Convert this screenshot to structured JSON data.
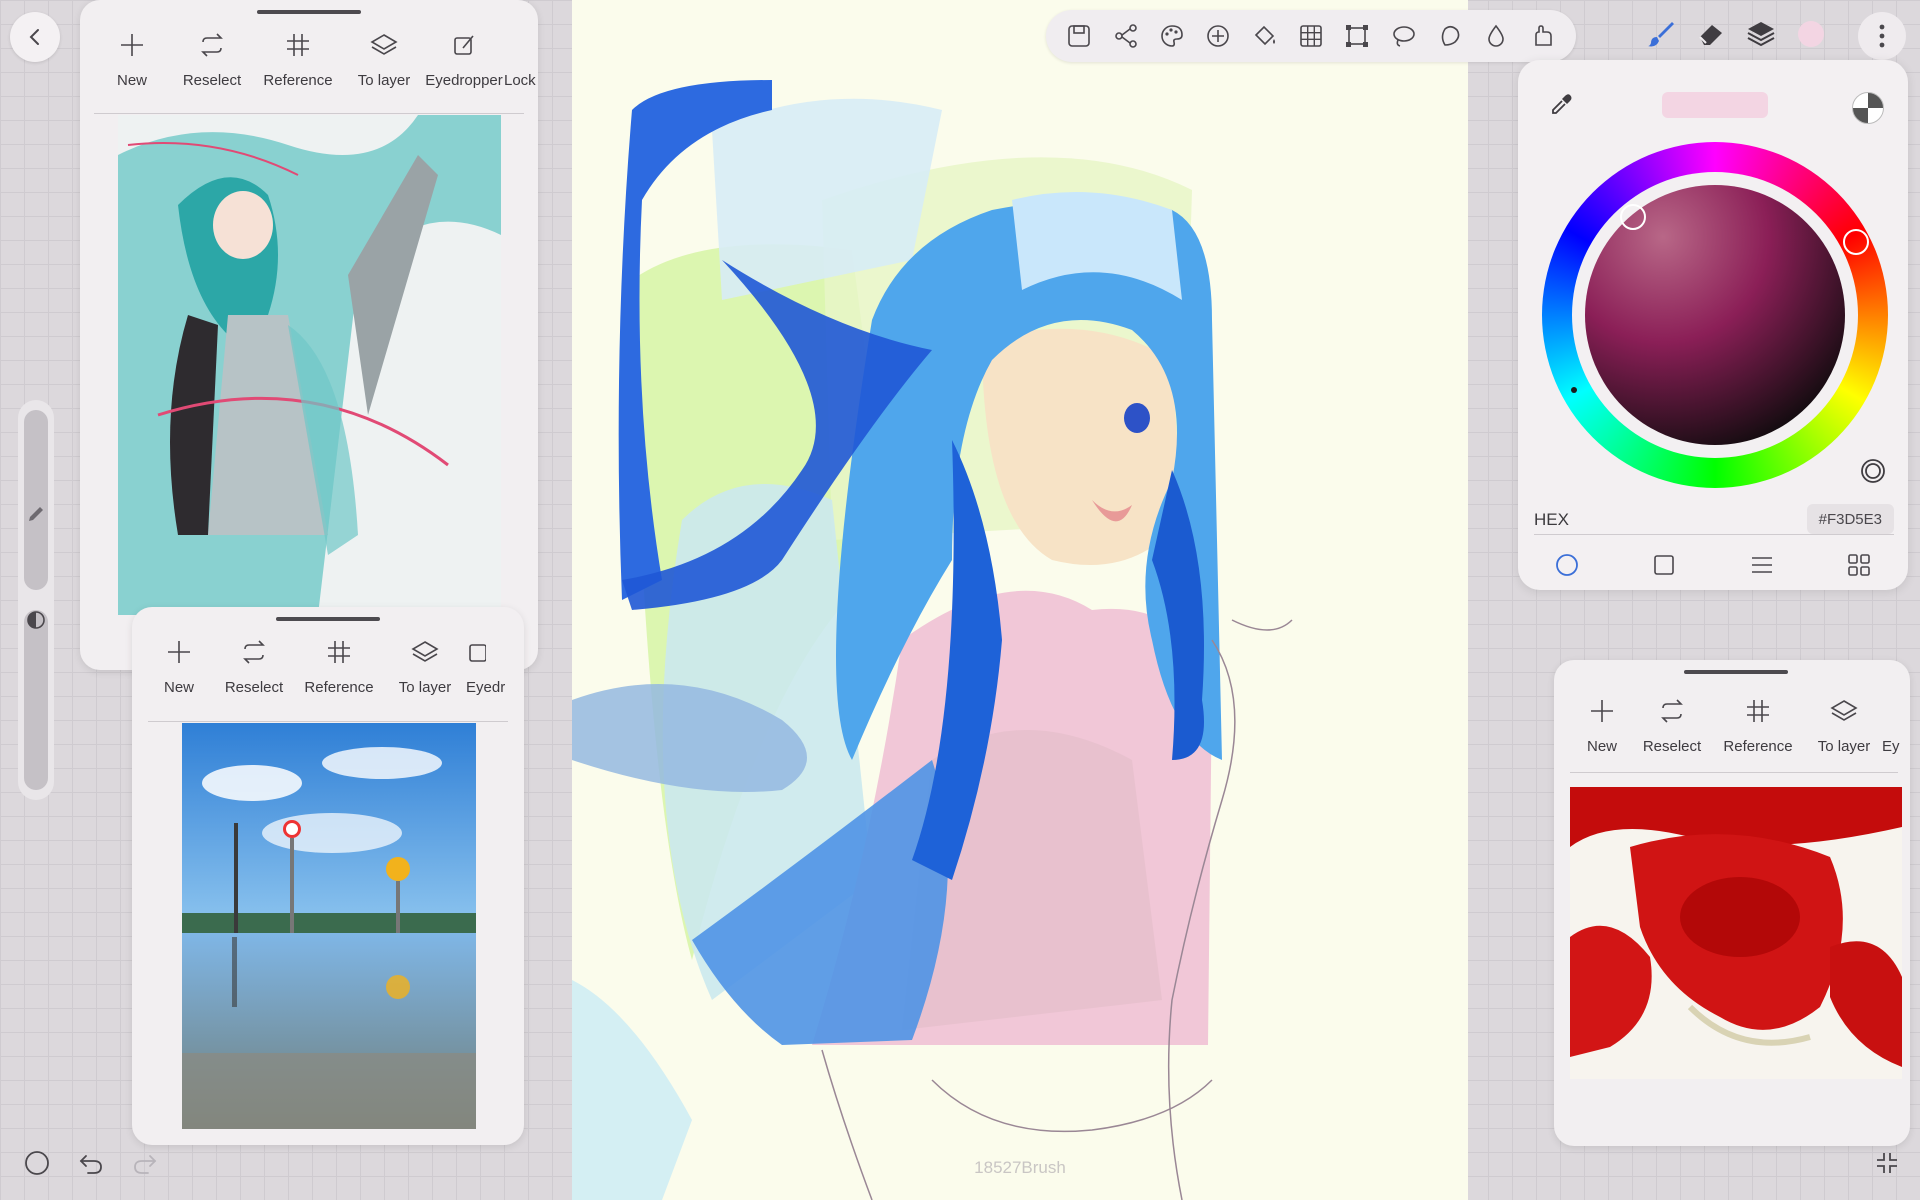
{
  "canvas": {
    "watermark": "18527Brush"
  },
  "ref_panel_1": {
    "tools": [
      {
        "label": "New",
        "icon": "plus-icon"
      },
      {
        "label": "Reselect",
        "icon": "reselect-icon"
      },
      {
        "label": "Reference",
        "icon": "grid-hash-icon"
      },
      {
        "label": "To layer",
        "icon": "layers-icon"
      },
      {
        "label": "Eyedropper",
        "icon": "edit-pen-icon"
      },
      {
        "label": "Lock",
        "icon": "lock-icon"
      }
    ]
  },
  "ref_panel_2": {
    "tools": [
      {
        "label": "New",
        "icon": "plus-icon"
      },
      {
        "label": "Reselect",
        "icon": "reselect-icon"
      },
      {
        "label": "Reference",
        "icon": "grid-hash-icon"
      },
      {
        "label": "To layer",
        "icon": "layers-icon"
      },
      {
        "label": "Eyedr",
        "icon": "edit-pen-icon"
      }
    ]
  },
  "ref_panel_3": {
    "tools": [
      {
        "label": "New",
        "icon": "plus-icon"
      },
      {
        "label": "Reselect",
        "icon": "reselect-icon"
      },
      {
        "label": "Reference",
        "icon": "grid-hash-icon"
      },
      {
        "label": "To layer",
        "icon": "layers-icon"
      },
      {
        "label": "Ey",
        "icon": "edit-pen-icon"
      }
    ]
  },
  "top_toolbar": {
    "icons": [
      "save-icon",
      "share-icon",
      "palette-icon",
      "add-circle-icon",
      "fill-bucket-icon",
      "grid-icon",
      "transform-icon",
      "lasso-icon",
      "shape-icon",
      "blur-drop-icon",
      "smudge-icon"
    ]
  },
  "right_tools": {
    "icons": [
      "brush-icon",
      "eraser-icon",
      "layers-icon",
      "color-swatch-icon"
    ],
    "active": "brush-icon"
  },
  "color_panel": {
    "hex_label": "HEX",
    "hex_value": "#F3D5E3",
    "current_color": "#f3d5e3",
    "modes": [
      "wheel-mode-icon",
      "square-mode-icon",
      "slider-mode-icon",
      "palette-grid-icon"
    ],
    "active_mode": "wheel-mode-icon"
  },
  "colors": {
    "accent": "#3b6fd8",
    "panel_bg": "#f2eff1",
    "canvas_bg": "#fbfcec"
  }
}
